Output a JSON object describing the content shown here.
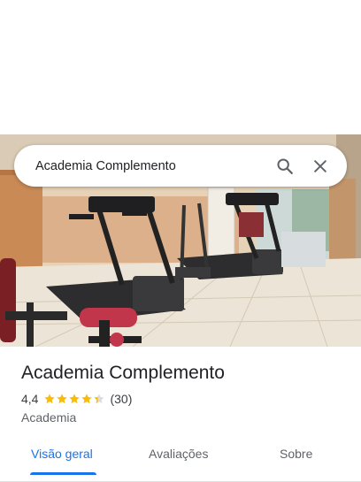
{
  "search": {
    "query": "Academia Complemento"
  },
  "place": {
    "title": "Academia Complemento",
    "rating": "4,4",
    "rating_value": 4.4,
    "review_count": "(30)",
    "category": "Academia"
  },
  "tabs": [
    {
      "label": "Visão geral",
      "active": true
    },
    {
      "label": "Avaliações",
      "active": false
    },
    {
      "label": "Sobre",
      "active": false
    }
  ],
  "icons": {
    "search": "search-icon",
    "close": "close-icon",
    "star": "star-icon"
  },
  "colors": {
    "accent": "#1a73e8",
    "star": "#fbbc04",
    "text": "#202124",
    "secondary": "#5f6368"
  }
}
